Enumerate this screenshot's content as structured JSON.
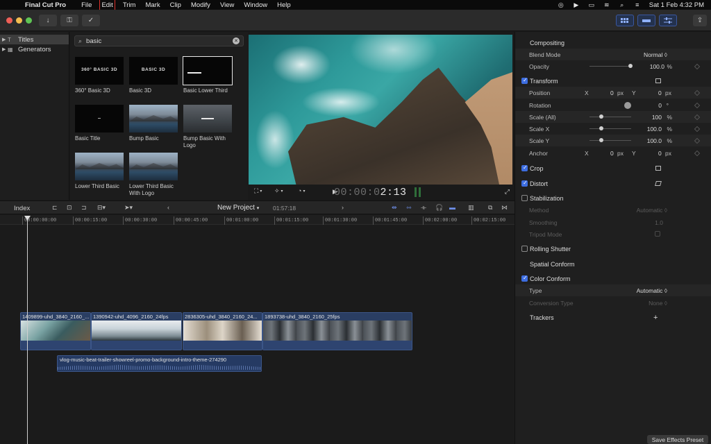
{
  "menubar": {
    "app_name": "Final Cut Pro",
    "items": [
      "File",
      "Edit",
      "Trim",
      "Mark",
      "Clip",
      "Modify",
      "View",
      "Window",
      "Help"
    ],
    "highlighted": "Edit",
    "date_time": "Sat 1 Feb  4:32 PM"
  },
  "sidebar": {
    "items": [
      {
        "label": "Titles",
        "selected": true
      },
      {
        "label": "Generators",
        "selected": false
      }
    ]
  },
  "browser": {
    "search_value": "basic",
    "tiles": [
      {
        "label": "360° Basic 3D",
        "thumb_text": "360° BASIC 3D"
      },
      {
        "label": "Basic 3D",
        "thumb_text": "BASIC 3D"
      },
      {
        "label": "Basic Lower Third",
        "thumb_text": ""
      },
      {
        "label": "Basic Title",
        "thumb_text": ""
      },
      {
        "label": "Bump Basic",
        "thumb_text": ""
      },
      {
        "label": "Bump Basic With Logo",
        "thumb_text": ""
      },
      {
        "label": "Lower Third Basic",
        "thumb_text": ""
      },
      {
        "label": "Lower Third Basic With Logo",
        "thumb_text": ""
      }
    ]
  },
  "viewer": {
    "timecode_dim": "00:00:0",
    "timecode_bright": "2:13"
  },
  "timeline": {
    "index_label": "Index",
    "project_name": "New Project",
    "duration": "01:57:18",
    "ruler": [
      "00:00:00:00",
      "00:00:15:00",
      "00:00:30:00",
      "00:00:45:00",
      "00:01:00:00",
      "00:01:15:00",
      "00:01:30:00",
      "00:01:45:00",
      "00:02:00:00",
      "00:02:15:00"
    ],
    "clips": [
      {
        "title": "1409899-uhd_3840_2160_...",
        "style": "sea"
      },
      {
        "title": "1390942-uhd_4096_2160_24fps",
        "style": "snow"
      },
      {
        "title": "2836305-uhd_3840_2160_24...",
        "style": "room"
      },
      {
        "title": "1893738-uhd_3840_2160_25fps",
        "style": "city"
      }
    ],
    "audio_title": "vlog-music-beat-trailer-showreel-promo-background-intro-theme-274290"
  },
  "inspector": {
    "compositing": "Compositing",
    "blend_mode_label": "Blend Mode",
    "blend_mode_value": "Normal ◊",
    "opacity_label": "Opacity",
    "opacity_value": "100.0",
    "opacity_unit": "%",
    "transform": "Transform",
    "position_label": "Position",
    "x_label": "X",
    "y_label": "Y",
    "pos_x": "0",
    "pos_y": "0",
    "px_unit": "px",
    "rotation_label": "Rotation",
    "rotation_value": "0",
    "deg_unit": "°",
    "scale_all_label": "Scale (All)",
    "scale_all_value": "100",
    "scale_x_label": "Scale X",
    "scale_x_value": "100.0",
    "scale_y_label": "Scale Y",
    "scale_y_value": "100.0",
    "percent_unit": "%",
    "anchor_label": "Anchor",
    "anchor_x": "0",
    "anchor_y": "0",
    "crop": "Crop",
    "distort": "Distort",
    "stabilization": "Stabilization",
    "method_label": "Method",
    "method_value": "Automatic ◊",
    "smoothing_label": "Smoothing",
    "smoothing_value": "1.0",
    "tripod_label": "Tripod Mode",
    "rolling_shutter": "Rolling Shutter",
    "spatial_conform": "Spatial Conform",
    "color_conform": "Color Conform",
    "type_label": "Type",
    "type_value": "Automatic ◊",
    "conversion_label": "Conversion Type",
    "conversion_value": "None ◊",
    "trackers": "Trackers",
    "trackers_add": "+",
    "save_preset": "Save Effects Preset"
  }
}
